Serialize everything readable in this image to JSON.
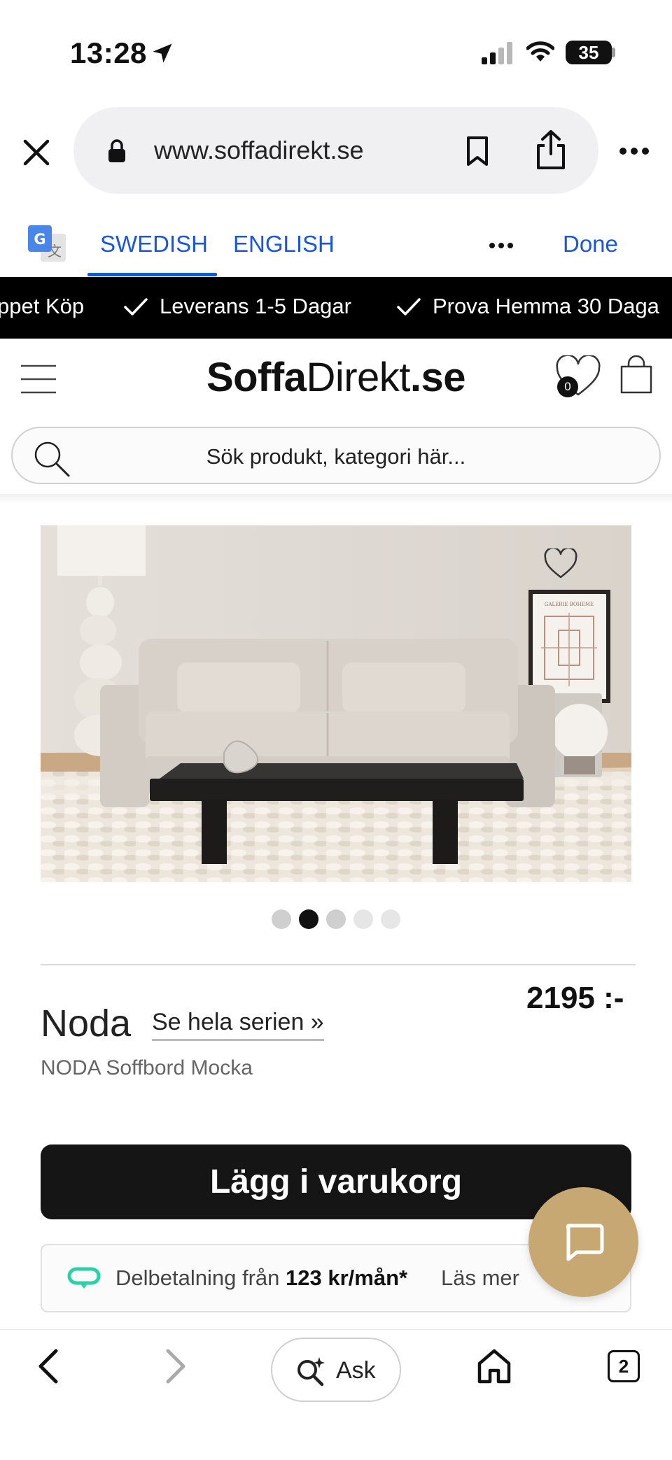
{
  "status_bar": {
    "time": "13:28",
    "battery": "35"
  },
  "browser": {
    "url": "www.soffadirekt.se"
  },
  "translate_bar": {
    "swedish": "SWEDISH",
    "english": "ENGLISH",
    "done": "Done"
  },
  "marquee": {
    "items": [
      "ppet Köp",
      "Leverans 1-5 Dagar",
      "Prova Hemma 30 Daga"
    ]
  },
  "site": {
    "logo_bold": "Soffa",
    "logo_regular": "Direkt",
    "logo_suffix": ".se",
    "wishlist_count": "0",
    "search_placeholder": "Sök produkt, kategori här..."
  },
  "product": {
    "name": "Noda",
    "series_link": "Se hela serien »",
    "price": "2195 :-",
    "subtitle": "NODA Soffbord Mocka",
    "add_to_cart": "Lägg i varukorg",
    "carousel_active_index": 1,
    "carousel_count": 5,
    "installment_prefix": "Delbetalning från",
    "installment_amount": "123 kr/mån*",
    "installment_more": "Läs mer",
    "poster_text": "GALERIE BOHEME"
  },
  "toolbar": {
    "ask": "Ask",
    "tab_count": "2"
  }
}
